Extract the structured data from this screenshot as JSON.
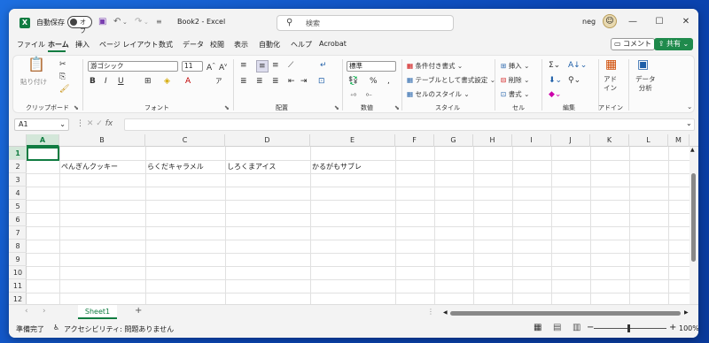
{
  "titlebar": {
    "autosave_label": "自動保存",
    "autosave_state": "オフ",
    "title": "Book2 - Excel",
    "search_placeholder": "検索",
    "user": "neg",
    "excel_icon": "X"
  },
  "menu": {
    "tabs": [
      "ファイル",
      "ホーム",
      "挿入",
      "ページ レイアウト",
      "数式",
      "データ",
      "校閲",
      "表示",
      "自動化",
      "ヘルプ",
      "Acrobat"
    ],
    "active_index": 1,
    "comment_label": "コメント",
    "share_label": "共有"
  },
  "ribbon": {
    "clipboard": {
      "paste": "貼り付け",
      "label": "クリップボード"
    },
    "font": {
      "name": "游ゴシック",
      "size": "11",
      "label": "フォント"
    },
    "alignment": {
      "label": "配置"
    },
    "number": {
      "format": "標準",
      "label": "数値"
    },
    "styles": {
      "conditional": "条件付き書式",
      "table": "テーブルとして書式設定",
      "cell_styles": "セルのスタイル",
      "label": "スタイル"
    },
    "cells": {
      "insert": "挿入",
      "delete": "削除",
      "format": "書式",
      "label": "セル"
    },
    "editing": {
      "label": "編集"
    },
    "addins": {
      "button": "アド\nイン",
      "label": "アドイン"
    },
    "analysis": {
      "button": "データ\n分析"
    }
  },
  "formula_bar": {
    "name_box": "A1",
    "fx": "fx",
    "value": ""
  },
  "grid": {
    "columns": [
      "A",
      "B",
      "C",
      "D",
      "E",
      "F",
      "G",
      "H",
      "I",
      "J",
      "K",
      "L",
      "M"
    ],
    "rows": [
      "1",
      "2",
      "3",
      "4",
      "5",
      "6",
      "7",
      "8",
      "9",
      "10",
      "11",
      "12"
    ],
    "selected_cell": "A1",
    "cells": [
      {
        "ref": "B2",
        "value": "ぺんぎんクッキー"
      },
      {
        "ref": "C2",
        "value": "らくだキャラメル"
      },
      {
        "ref": "D2",
        "value": "しろくまアイス"
      },
      {
        "ref": "E2",
        "value": "かるがもサブレ"
      }
    ]
  },
  "sheets": {
    "tabs": [
      "Sheet1"
    ],
    "add": "+"
  },
  "status": {
    "ready": "準備完了",
    "accessibility": "アクセシビリティ: 問題ありません",
    "zoom": "100%"
  },
  "colors": {
    "accent": "#107c41",
    "share": "#1f8a4c"
  }
}
